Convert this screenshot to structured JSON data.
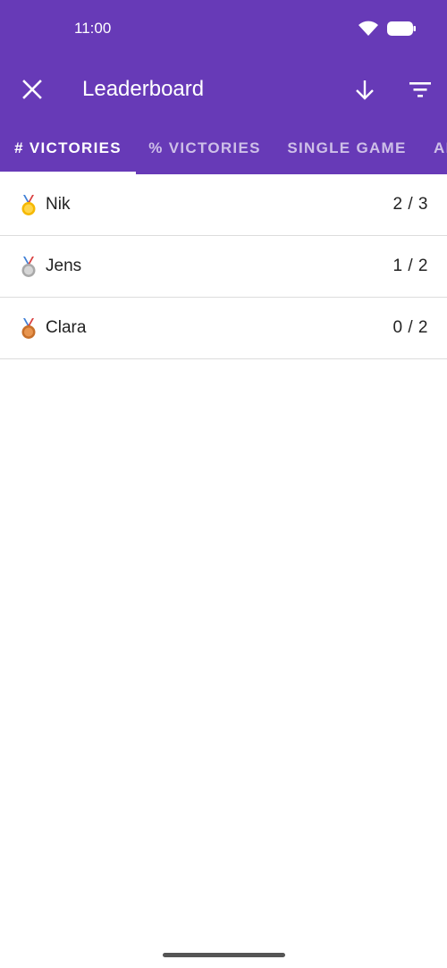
{
  "status_bar": {
    "time": "11:00",
    "icons": [
      "wifi-icon",
      "battery-icon"
    ]
  },
  "app_bar": {
    "title": "Leaderboard",
    "close_icon": "close-icon",
    "sort_icon": "arrow-down-icon",
    "filter_icon": "filter-icon",
    "background_color": "#673ab7"
  },
  "tabs": [
    {
      "label": "# VICTORIES",
      "active": true
    },
    {
      "label": "% VICTORIES",
      "active": false
    },
    {
      "label": "SINGLE GAME",
      "active": false
    },
    {
      "label": "AI",
      "active": false
    }
  ],
  "leaderboard": [
    {
      "medal": "gold-medal-icon",
      "name": "Nik",
      "score": "2 / 3"
    },
    {
      "medal": "silver-medal-icon",
      "name": "Jens",
      "score": "1 / 2"
    },
    {
      "medal": "bronze-medal-icon",
      "name": "Clara",
      "score": "0 / 2"
    }
  ]
}
